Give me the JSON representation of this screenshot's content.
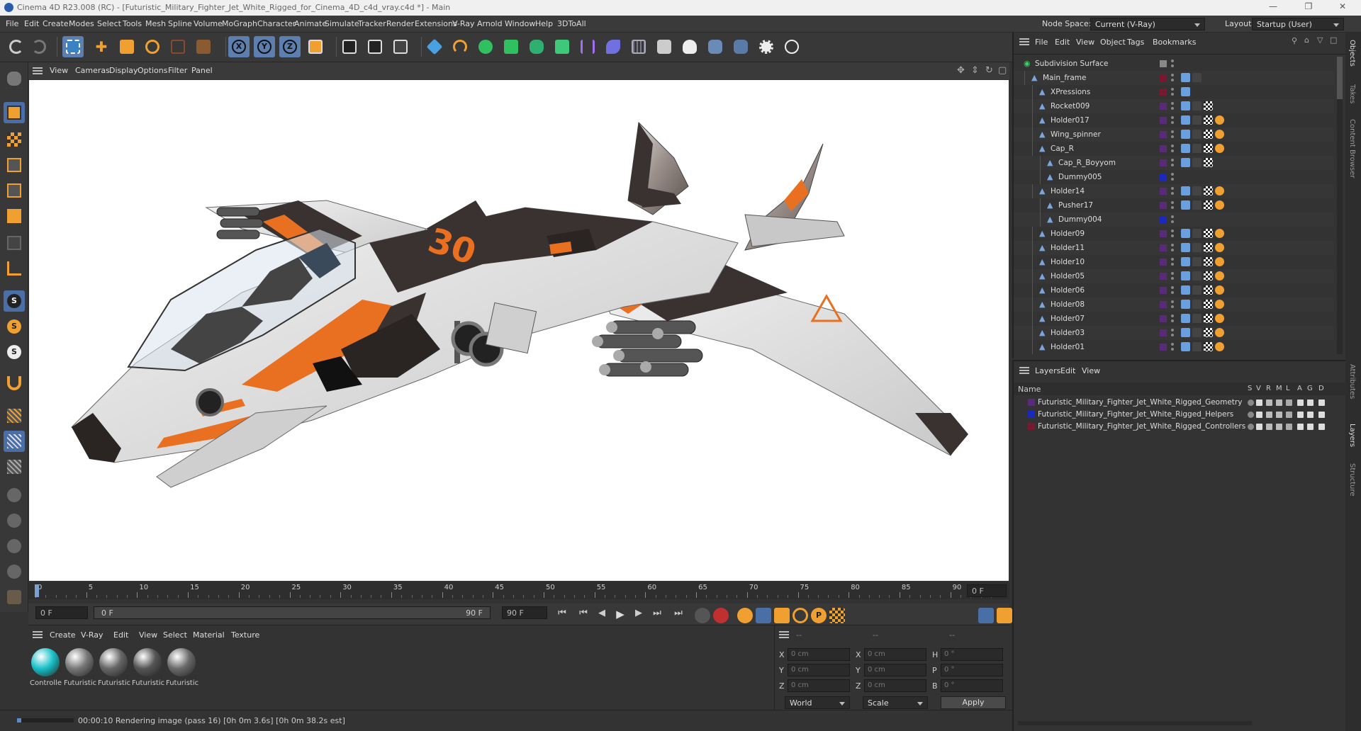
{
  "window": {
    "title": "Cinema 4D R23.008 (RC) - [Futuristic_Military_Fighter_Jet_White_Rigged_for_Cinema_4D_c4d_vray.c4d *] - Main"
  },
  "menubar": {
    "items": [
      "File",
      "Edit",
      "Create",
      "Modes",
      "Select",
      "Tools",
      "Mesh",
      "Spline",
      "Volume",
      "MoGraph",
      "Character",
      "Animate",
      "Simulate",
      "Tracker",
      "Render",
      "Extensions",
      "V-Ray",
      "Arnold",
      "Window",
      "Help",
      "3DToAll"
    ],
    "node_space_label": "Node Space:",
    "node_space_value": "Current (V-Ray)",
    "layout_label": "Layout:",
    "layout_value": "Startup (User)"
  },
  "viewport": {
    "menu": [
      "View",
      "Cameras",
      "Display",
      "Options",
      "Filter",
      "Panel"
    ]
  },
  "timeline": {
    "ticks": [
      "0",
      "5",
      "10",
      "15",
      "20",
      "25",
      "30",
      "35",
      "40",
      "45",
      "50",
      "55",
      "60",
      "65",
      "70",
      "75",
      "80",
      "85",
      "90"
    ],
    "current_frame_display": "0 F",
    "start_field": "0 F",
    "slider_start": "0 F",
    "slider_end": "90 F",
    "end_field": "90 F"
  },
  "material_panel": {
    "menu": [
      "Create",
      "V-Ray",
      "Edit",
      "View",
      "Select",
      "Material",
      "Texture"
    ],
    "materials": [
      {
        "label": "Controlle",
        "color": "#18c0c8"
      },
      {
        "label": "Futuristic",
        "color": "#777"
      },
      {
        "label": "Futuristic",
        "color": "#666"
      },
      {
        "label": "Futuristic",
        "color": "#555"
      },
      {
        "label": "Futuristic",
        "color": "#6a6a6a"
      }
    ]
  },
  "coord_panel": {
    "headers": [
      "--",
      "--",
      "--"
    ],
    "rows": [
      {
        "a": "X",
        "av": "0 cm",
        "b": "X",
        "bv": "0 cm",
        "c": "H",
        "cv": "0 °"
      },
      {
        "a": "Y",
        "av": "0 cm",
        "b": "Y",
        "bv": "0 cm",
        "c": "P",
        "cv": "0 °"
      },
      {
        "a": "Z",
        "av": "0 cm",
        "b": "Z",
        "bv": "0 cm",
        "c": "B",
        "cv": "0 °"
      }
    ],
    "mode1": "World",
    "mode2": "Scale",
    "apply": "Apply"
  },
  "status": {
    "text": "00:00:10 Rendering image (pass 16) [0h  0m  3.6s] [0h  0m 38.2s est]"
  },
  "object_manager": {
    "menu": [
      "File",
      "Edit",
      "View",
      "Object",
      "Tags",
      "Bookmarks"
    ],
    "rows": [
      {
        "name": "Subdivision Surface",
        "indent": 0,
        "color": "#888",
        "tags": 0
      },
      {
        "name": "Main_frame",
        "indent": 1,
        "color": "#7a1830",
        "tags": 2
      },
      {
        "name": "XPressions",
        "indent": 2,
        "color": "#7a1830",
        "tags": 1
      },
      {
        "name": "Rocket009",
        "indent": 2,
        "color": "#5a2a7a",
        "tags": 3
      },
      {
        "name": "Holder017",
        "indent": 2,
        "color": "#5a2a7a",
        "tags": 4
      },
      {
        "name": "Wing_spinner",
        "indent": 2,
        "color": "#5a2a7a",
        "tags": 4
      },
      {
        "name": "Cap_R",
        "indent": 2,
        "color": "#5a2a7a",
        "tags": 4
      },
      {
        "name": "Cap_R_Boyyom",
        "indent": 3,
        "color": "#5a2a7a",
        "tags": 3
      },
      {
        "name": "Dummy005",
        "indent": 3,
        "color": "#1a28c0",
        "tags": 0
      },
      {
        "name": "Holder14",
        "indent": 2,
        "color": "#5a2a7a",
        "tags": 4
      },
      {
        "name": "Pusher17",
        "indent": 3,
        "color": "#5a2a7a",
        "tags": 4
      },
      {
        "name": "Dummy004",
        "indent": 3,
        "color": "#1a28c0",
        "tags": 0
      },
      {
        "name": "Holder09",
        "indent": 2,
        "color": "#5a2a7a",
        "tags": 4
      },
      {
        "name": "Holder11",
        "indent": 2,
        "color": "#5a2a7a",
        "tags": 4
      },
      {
        "name": "Holder10",
        "indent": 2,
        "color": "#5a2a7a",
        "tags": 4
      },
      {
        "name": "Holder05",
        "indent": 2,
        "color": "#5a2a7a",
        "tags": 4
      },
      {
        "name": "Holder06",
        "indent": 2,
        "color": "#5a2a7a",
        "tags": 4
      },
      {
        "name": "Holder08",
        "indent": 2,
        "color": "#5a2a7a",
        "tags": 4
      },
      {
        "name": "Holder07",
        "indent": 2,
        "color": "#5a2a7a",
        "tags": 4
      },
      {
        "name": "Holder03",
        "indent": 2,
        "color": "#5a2a7a",
        "tags": 4
      },
      {
        "name": "Holder01",
        "indent": 2,
        "color": "#5a2a7a",
        "tags": 4
      }
    ]
  },
  "layer_manager": {
    "menu": [
      "Layers",
      "Edit",
      "View"
    ],
    "name_header": "Name",
    "col_headers": [
      "S",
      "V",
      "R",
      "M",
      "L",
      "A",
      "G",
      "D"
    ],
    "rows": [
      {
        "name": "Futuristic_Military_Fighter_Jet_White_Rigged_Geometry",
        "color": "#5a2a7a"
      },
      {
        "name": "Futuristic_Military_Fighter_Jet_White_Rigged_Helpers",
        "color": "#1a28c0"
      },
      {
        "name": "Futuristic_Military_Fighter_Jet_White_Rigged_Controllers",
        "color": "#7a1830"
      }
    ]
  },
  "side_tabs": {
    "top": [
      "Objects",
      "Takes",
      "Content Browser"
    ],
    "bottom": [
      "Attributes",
      "Layers",
      "Structure"
    ]
  }
}
